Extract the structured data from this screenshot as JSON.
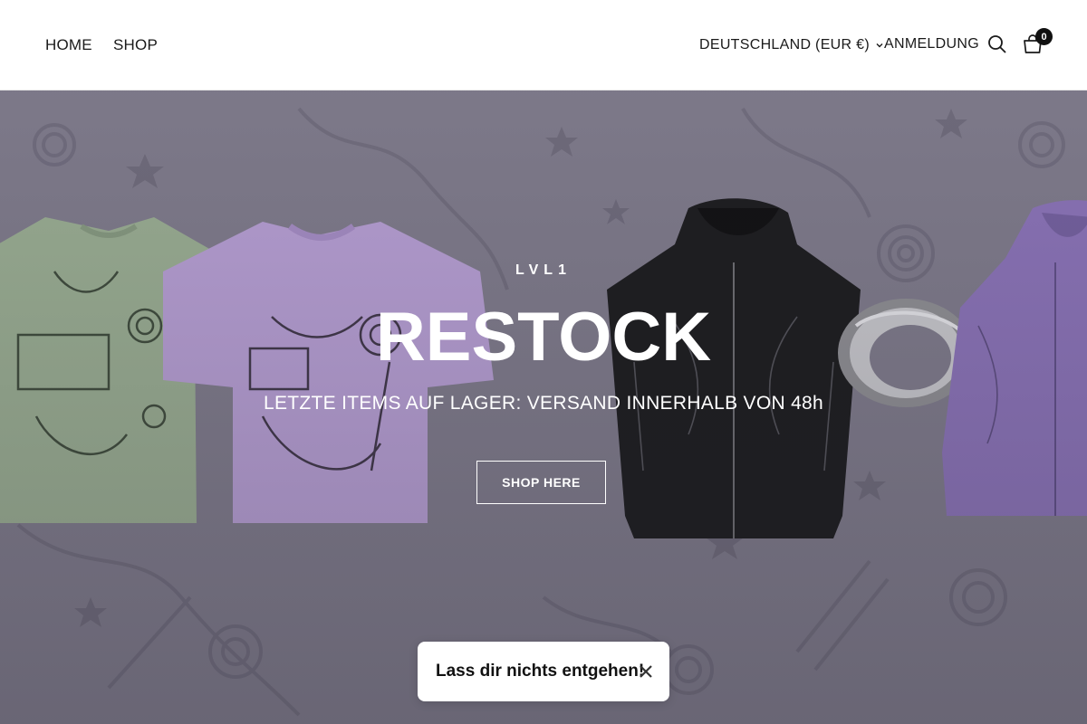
{
  "header": {
    "nav": [
      {
        "label": "HOME"
      },
      {
        "label": "SHOP"
      }
    ],
    "country_selector": "DEUTSCHLAND (EUR €)",
    "login": "ANMELDUNG",
    "cart_count": "0",
    "icons": [
      "search-icon",
      "cart-icon",
      "chevron-down-icon"
    ]
  },
  "hero": {
    "eyebrow": "LVL1",
    "headline": "RESTOCK",
    "subline": "LETZTE ITEMS AUF LAGER: VERSAND INNERHALB VON 48h",
    "cta_label": "SHOP HERE",
    "colors": {
      "background": "#7f7b8b",
      "tee_green": "#9aae92",
      "tee_lavender": "#b79fd4",
      "hoodie_black": "#1b1b1d",
      "hoodie_purple": "#8b73b8"
    }
  },
  "toast": {
    "text": "Lass dir nichts entgehen!"
  }
}
